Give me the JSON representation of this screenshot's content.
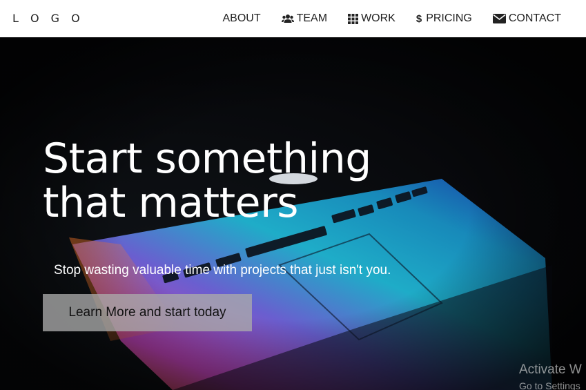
{
  "header": {
    "logo": "L O G O",
    "nav": [
      {
        "label": "ABOUT",
        "icon": "none"
      },
      {
        "label": "TEAM",
        "icon": "users-icon"
      },
      {
        "label": "WORK",
        "icon": "grid-icon"
      },
      {
        "label": "PRICING",
        "icon": "dollar-icon"
      },
      {
        "label": "CONTACT",
        "icon": "envelope-icon"
      }
    ]
  },
  "hero": {
    "headline_line1": "Start something",
    "headline_line2": "that matters",
    "subtitle": "Stop wasting valuable time with projects that just isn't you.",
    "cta_label": "Learn More and start today"
  },
  "watermark": {
    "title": "Activate W",
    "subtitle": "Go to Settings"
  },
  "colors": {
    "navbar_bg": "#ffffff",
    "hero_bg": "#07080b",
    "text_light": "#ffffff",
    "cta_bg": "#aaaaaa"
  }
}
